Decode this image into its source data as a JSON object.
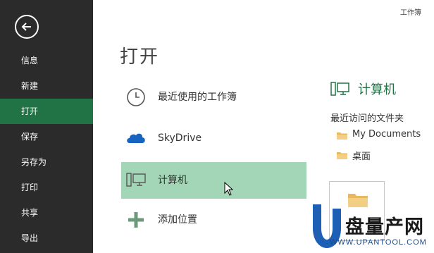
{
  "window": {
    "title_partial": "工作簿"
  },
  "sidebar": {
    "items": [
      {
        "label": "信息",
        "active": false
      },
      {
        "label": "新建",
        "active": false
      },
      {
        "label": "打开",
        "active": true
      },
      {
        "label": "保存",
        "active": false
      },
      {
        "label": "另存为",
        "active": false
      },
      {
        "label": "打印",
        "active": false
      },
      {
        "label": "共享",
        "active": false
      },
      {
        "label": "导出",
        "active": false
      }
    ]
  },
  "main": {
    "title": "打开",
    "places": [
      {
        "label": "最近使用的工作簿",
        "icon": "clock-icon",
        "selected": false
      },
      {
        "label": "SkyDrive",
        "icon": "cloud-icon",
        "selected": false
      },
      {
        "label": "计算机",
        "icon": "computer-icon",
        "selected": true
      },
      {
        "label": "添加位置",
        "icon": "plus-icon",
        "selected": false
      }
    ]
  },
  "right_panel": {
    "title": "计算机",
    "recent_heading": "最近访问的文件夹",
    "folders": [
      {
        "label": "My Documents",
        "icon": "folder-icon"
      },
      {
        "label": "桌面",
        "icon": "folder-icon"
      }
    ],
    "browse_icon": "folder-icon"
  },
  "watermark": {
    "brand": "盘量产网",
    "url": "WWW.UPANTOOL.COM",
    "logo_letter": "U"
  },
  "colors": {
    "accent": "#217346",
    "sidebar_bg": "#2b2b2b",
    "selected_bg": "#a3d6b6"
  }
}
